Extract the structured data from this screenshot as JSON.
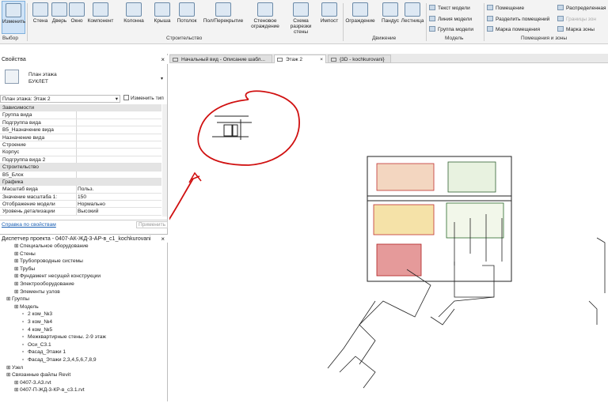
{
  "ribbon": {
    "modify": "Изменить",
    "select": "Выбор",
    "buttons": [
      "Стена",
      "Дверь",
      "Окно",
      "Компонент",
      "Колонна",
      "Крыша",
      "Потолок",
      "Пол/Перекрытие",
      "Стеновое ограждение",
      "Схема разрезки стены",
      "Импост",
      "Ограждение",
      "Пандус",
      "Лестница"
    ],
    "groups": {
      "build": "Строительство",
      "move": "Движение",
      "model": "Модель",
      "rooms": "Помещения и зоны"
    },
    "model_items": [
      "Текст модели",
      "Линия модели",
      "Группа модели"
    ],
    "room_items": [
      "Помещение",
      "Разделить помещений",
      "Марка помещения"
    ],
    "room_items2": [
      "Распределенная",
      "Границы зон",
      "Марка зоны"
    ]
  },
  "properties": {
    "title": "Свойства",
    "type_line1": "План этажа",
    "type_line2": "БУКЛЕТ",
    "instance": "План этажа: Этаж 2",
    "edit_type": "Изменить тип",
    "rows": [
      {
        "k": "Зависимости",
        "v": "",
        "cat": true
      },
      {
        "k": "Группа вида",
        "v": ""
      },
      {
        "k": "Подгруппа вида",
        "v": ""
      },
      {
        "k": "B5_Назначение вида",
        "v": ""
      },
      {
        "k": "Назначение вида",
        "v": ""
      },
      {
        "k": "Строение",
        "v": ""
      },
      {
        "k": "Корпус",
        "v": ""
      },
      {
        "k": "Подгруппа вида 2",
        "v": ""
      },
      {
        "k": "Строительство",
        "v": "",
        "cat": true
      },
      {
        "k": "B5_Блок",
        "v": ""
      },
      {
        "k": "Графика",
        "v": "",
        "cat": true
      },
      {
        "k": "Масштаб вида",
        "v": "Польз."
      },
      {
        "k": "Значение масштаба    1:",
        "v": "150"
      },
      {
        "k": "Отображение модели",
        "v": "Нормально"
      },
      {
        "k": "Уровень детализации",
        "v": "Высокий"
      }
    ],
    "help": "Справка по свойствам",
    "apply": "Применить"
  },
  "browser": {
    "title": "Диспетчер проекта - 0407-АК-ЖД-3-АР-в_с1_kochkurovani",
    "items": [
      "Специальное оборудование",
      "Стены",
      "Трубопроводные системы",
      "Трубы",
      "Фундамент несущей конструкции",
      "Электрооборудование",
      "Элементы узлов",
      "Группы",
      "Модель",
      "2 ком_№3",
      "3 ком_№4",
      "4 ком_№5",
      "Межквартирные стены. 2-9  этаж",
      "Оси_С3.1",
      "Фасад_Этажи 1",
      "Фасад_Этажи 2,3,4,5,6,7,8,9",
      "Узел",
      "Связанные файлы Revit",
      "0407-3.А3.rvt",
      "0407-П-ЖД-3-КР-в_с3.1.rvt"
    ]
  },
  "tabs": [
    "Начальный вид - Описание шабл...",
    "Этаж 2",
    "{3D - kochkurovani}"
  ]
}
